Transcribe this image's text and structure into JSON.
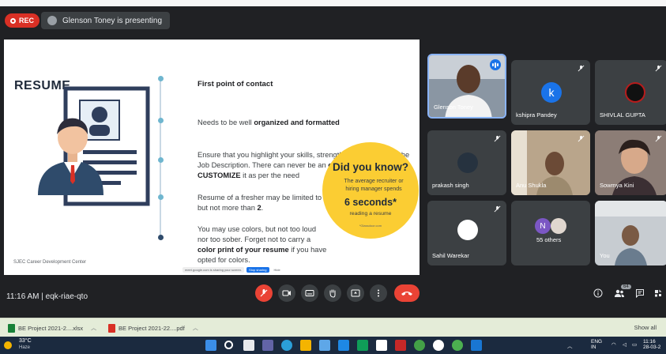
{
  "meet": {
    "rec_label": "REC",
    "presenter_text": "Glenson Toney is presenting",
    "time_and_code": "11:16 AM  |  eqk-riae-qto",
    "people_badge": "64"
  },
  "slide": {
    "title": "RESUME",
    "points": [
      {
        "text": "First point of contact",
        "kind": "head"
      },
      {
        "html": "Needs to be well <b>organized and formatted</b>"
      },
      {
        "html": "Ensure that you highlight your skills, strengths and match it to the Job Description. There can never be an <b>one for all</b> resume. <b>CUSTOMIZE</b> it as per the need"
      },
      {
        "html": "Resume of a fresher may be limited to <b>1 page</b> but not more than <b>2</b>."
      },
      {
        "html": "You may use colors, but not too loud nor too sober. Forget not to carry a <b>color print of your resume</b> if you have opted for colors."
      }
    ],
    "footer": "SJEC Career Development Center",
    "did_you_know": {
      "title": "Did you know?",
      "sub": "The average recruiter or hiring manager spends",
      "big": "6 seconds*",
      "tail": "reading a resume",
      "source": "*Glassdoor.com"
    },
    "share_strip": {
      "message": "meet.google.com is sharing your screen.",
      "stop": "Stop sharing",
      "hide": "Hide"
    }
  },
  "participants": [
    {
      "name": "Glenson Toney",
      "kind": "video"
    },
    {
      "name": "kshipra Pandey",
      "kind": "letter",
      "letter": "k",
      "color": "#1a73e8"
    },
    {
      "name": "SHIVLAL GUPTA",
      "kind": "photo"
    },
    {
      "name": "prakash singh",
      "kind": "photo"
    },
    {
      "name": "Anu Shukla",
      "kind": "video"
    },
    {
      "name": "Sowmya Kini",
      "kind": "video"
    },
    {
      "name": "Sahil Warekar",
      "kind": "photo"
    },
    {
      "name": "55 others",
      "kind": "group",
      "letter": "N"
    },
    {
      "name": "You",
      "kind": "video"
    }
  ],
  "downloads": {
    "items": [
      {
        "name": "BE Project 2021-2....xlsx"
      },
      {
        "name": "BE Project 2021-22....pdf"
      }
    ],
    "show_all": "Show all"
  },
  "taskbar": {
    "temp": "33°C",
    "weather": "Haze",
    "lang_top": "ENG",
    "lang_bottom": "IN",
    "time": "11:16",
    "date": "28-03-2"
  },
  "colors": {
    "meet_bg": "#202124",
    "tile_bg": "#3c4043",
    "rec_red": "#d93025",
    "yellow": "#fbcd33",
    "accent_blue": "#1a73e8",
    "end_call_red": "#ea4335"
  }
}
